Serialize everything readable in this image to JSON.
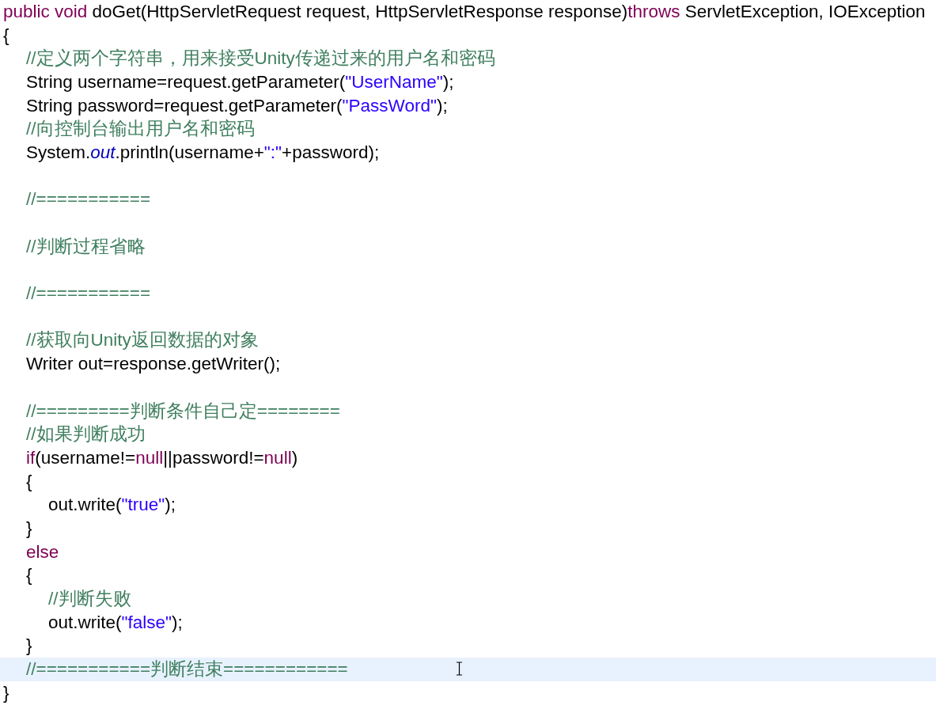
{
  "editor": {
    "lines": [
      {
        "kind": "code",
        "current": false,
        "tokens": [
          {
            "kind": "keyword",
            "text": "public void "
          },
          {
            "kind": "plain",
            "text": "doGet(HttpServletRequest request, HttpServletResponse response)"
          },
          {
            "kind": "keyword",
            "text": "throws "
          },
          {
            "kind": "plain",
            "text": "ServletException, IOException"
          }
        ]
      },
      {
        "kind": "code",
        "current": false,
        "tokens": [
          {
            "kind": "plain",
            "text": "{"
          }
        ],
        "children": [
          {
            "kind": "code",
            "current": false,
            "tokens": [
              {
                "kind": "comment",
                "text": "//定义两个字符串，用来接受Unity传递过来的用户名和密码"
              }
            ]
          },
          {
            "kind": "code",
            "current": false,
            "tokens": [
              {
                "kind": "plain",
                "text": "String username=request.getParameter("
              },
              {
                "kind": "string",
                "text": "\"UserName\""
              },
              {
                "kind": "plain",
                "text": ");"
              }
            ]
          },
          {
            "kind": "code",
            "current": false,
            "tokens": [
              {
                "kind": "plain",
                "text": "String password=request.getParameter("
              },
              {
                "kind": "string",
                "text": "\"PassWord\""
              },
              {
                "kind": "plain",
                "text": ");"
              }
            ]
          },
          {
            "kind": "code",
            "current": false,
            "tokens": [
              {
                "kind": "comment",
                "text": "//向控制台输出用户名和密码"
              }
            ]
          },
          {
            "kind": "code",
            "current": false,
            "tokens": [
              {
                "kind": "plain",
                "text": "System."
              },
              {
                "kind": "field",
                "text": "out"
              },
              {
                "kind": "plain",
                "text": ".println(username+"
              },
              {
                "kind": "string",
                "text": "\":\""
              },
              {
                "kind": "plain",
                "text": "+password);"
              }
            ]
          },
          {
            "kind": "blank",
            "current": false
          },
          {
            "kind": "code",
            "current": false,
            "tokens": [
              {
                "kind": "comment",
                "text": "//==========="
              }
            ]
          },
          {
            "kind": "blank",
            "current": false
          },
          {
            "kind": "code",
            "current": false,
            "tokens": [
              {
                "kind": "comment",
                "text": "//判断过程省略"
              }
            ]
          },
          {
            "kind": "blank",
            "current": false
          },
          {
            "kind": "code",
            "current": false,
            "tokens": [
              {
                "kind": "comment",
                "text": "//==========="
              }
            ]
          },
          {
            "kind": "blank",
            "current": false
          },
          {
            "kind": "code",
            "current": false,
            "tokens": [
              {
                "kind": "comment",
                "text": "//获取向Unity返回数据的对象"
              }
            ]
          },
          {
            "kind": "code",
            "current": false,
            "tokens": [
              {
                "kind": "plain",
                "text": "Writer out=response.getWriter();"
              }
            ]
          },
          {
            "kind": "blank",
            "current": false
          },
          {
            "kind": "code",
            "current": false,
            "tokens": [
              {
                "kind": "comment",
                "text": "//=========判断条件自己定========"
              }
            ]
          },
          {
            "kind": "code",
            "current": false,
            "tokens": [
              {
                "kind": "comment",
                "text": "//如果判断成功"
              }
            ]
          },
          {
            "kind": "code",
            "current": false,
            "tokens": [
              {
                "kind": "keyword",
                "text": "if"
              },
              {
                "kind": "plain",
                "text": "(username!="
              },
              {
                "kind": "keyword",
                "text": "null"
              },
              {
                "kind": "plain",
                "text": "||password!="
              },
              {
                "kind": "keyword",
                "text": "null"
              },
              {
                "kind": "plain",
                "text": ")"
              }
            ]
          },
          {
            "kind": "code",
            "current": false,
            "tokens": [
              {
                "kind": "plain",
                "text": "{"
              }
            ],
            "children": [
              {
                "kind": "code",
                "current": false,
                "tokens": [
                  {
                    "kind": "plain",
                    "text": "out.write("
                  },
                  {
                    "kind": "string",
                    "text": "\"true\""
                  },
                  {
                    "kind": "plain",
                    "text": ");"
                  }
                ]
              }
            ]
          },
          {
            "kind": "code",
            "current": false,
            "tokens": [
              {
                "kind": "plain",
                "text": "}"
              }
            ]
          },
          {
            "kind": "code",
            "current": false,
            "tokens": [
              {
                "kind": "keyword",
                "text": "else"
              }
            ]
          },
          {
            "kind": "code",
            "current": false,
            "tokens": [
              {
                "kind": "plain",
                "text": "{"
              }
            ],
            "children": [
              {
                "kind": "code",
                "current": false,
                "tokens": [
                  {
                    "kind": "comment",
                    "text": "//判断失败"
                  }
                ]
              },
              {
                "kind": "code",
                "current": false,
                "tokens": [
                  {
                    "kind": "plain",
                    "text": "out.write("
                  },
                  {
                    "kind": "string",
                    "text": "\"false\""
                  },
                  {
                    "kind": "plain",
                    "text": ");"
                  }
                ]
              }
            ]
          },
          {
            "kind": "code",
            "current": false,
            "tokens": [
              {
                "kind": "plain",
                "text": "}"
              }
            ]
          },
          {
            "kind": "code",
            "current": true,
            "tokens": [
              {
                "kind": "comment",
                "text": "//===========判断结束============"
              }
            ]
          }
        ]
      },
      {
        "kind": "code",
        "current": false,
        "tokens": [
          {
            "kind": "plain",
            "text": "}"
          }
        ]
      }
    ]
  }
}
